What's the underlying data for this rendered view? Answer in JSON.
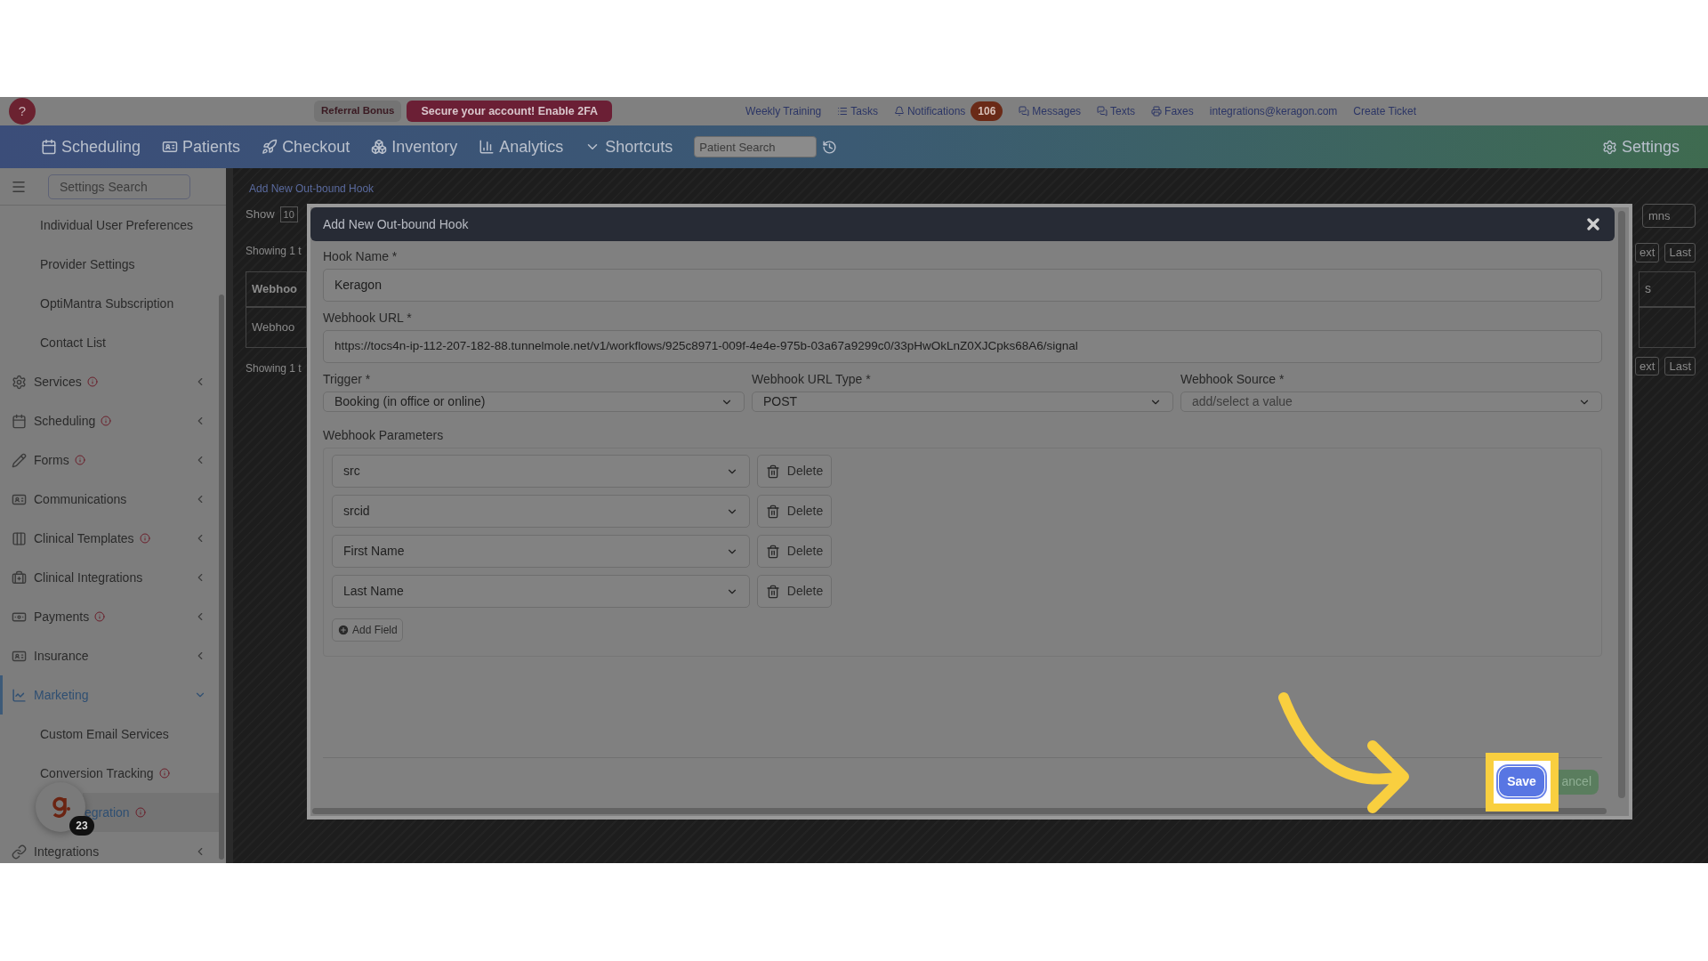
{
  "top_bar": {
    "help": "?",
    "badges": [
      {
        "label": "Referral Bonus",
        "kind": "plain"
      },
      {
        "label": "Secure your account! Enable 2FA",
        "kind": "alert"
      }
    ],
    "links": [
      {
        "label": "Weekly Training"
      },
      {
        "label": "Tasks"
      },
      {
        "label": "Notifications",
        "count": "106"
      },
      {
        "label": "Messages"
      },
      {
        "label": "Texts"
      },
      {
        "label": "Faxes"
      },
      {
        "label": "integrations@keragon.com"
      },
      {
        "label": "Create Ticket"
      }
    ]
  },
  "nav": {
    "items": [
      {
        "label": "Scheduling"
      },
      {
        "label": "Patients"
      },
      {
        "label": "Checkout"
      },
      {
        "label": "Inventory"
      },
      {
        "label": "Analytics"
      },
      {
        "label": "Shortcuts"
      }
    ],
    "search_placeholder": "Patient Search",
    "settings": "Settings"
  },
  "sidebar": {
    "search_placeholder": "Settings Search",
    "items": [
      {
        "label": "Individual User Preferences",
        "kind": "sub",
        "info": false,
        "selected": false
      },
      {
        "label": "Provider Settings",
        "kind": "sub",
        "info": false,
        "selected": false
      },
      {
        "label": "OptiMantra Subscription",
        "kind": "sub",
        "info": false,
        "selected": false
      },
      {
        "label": "Contact List",
        "kind": "sub",
        "info": false,
        "selected": false
      },
      {
        "label": "Services",
        "kind": "section",
        "info": true,
        "expanded": false,
        "selected": false
      },
      {
        "label": "Scheduling",
        "kind": "section",
        "info": true,
        "expanded": false,
        "selected": false
      },
      {
        "label": "Forms",
        "kind": "section",
        "info": true,
        "expanded": false,
        "selected": false
      },
      {
        "label": "Communications",
        "kind": "section",
        "info": false,
        "expanded": false,
        "selected": false
      },
      {
        "label": "Clinical Templates",
        "kind": "section",
        "info": true,
        "expanded": false,
        "selected": false
      },
      {
        "label": "Clinical Integrations",
        "kind": "section",
        "info": false,
        "expanded": false,
        "selected": false
      },
      {
        "label": "Payments",
        "kind": "section",
        "info": true,
        "expanded": false,
        "selected": false
      },
      {
        "label": "Insurance",
        "kind": "section",
        "info": false,
        "expanded": false,
        "selected": false
      },
      {
        "label": "Marketing",
        "kind": "section",
        "info": false,
        "expanded": true,
        "selected": true
      },
      {
        "label": "Custom Email Services",
        "kind": "sub",
        "info": false,
        "selected": false
      },
      {
        "label": "Conversion Tracking",
        "kind": "sub",
        "info": true,
        "selected": false
      },
      {
        "label": "egration",
        "kind": "sub",
        "info": true,
        "selected": true
      },
      {
        "label": "Integrations",
        "kind": "section",
        "info": false,
        "expanded": false,
        "selected": false
      }
    ]
  },
  "background": {
    "link": "Add New Out-bound Hook",
    "show_label": "Show",
    "show_value": "10",
    "left_texts": [
      "Showing 1 t",
      "Webhoo",
      "Webhoo",
      "Showing 1 t"
    ],
    "columns_button": "mns",
    "pager_top": [
      "ext",
      "Last"
    ],
    "table_header": "s",
    "pager_bottom": [
      "ext",
      "Last"
    ]
  },
  "modal": {
    "title": "Add New Out-bound Hook",
    "hook_name": {
      "label": "Hook Name *",
      "value": "Keragon"
    },
    "webhook_url": {
      "label": "Webhook URL *",
      "value": "https://tocs4n-ip-112-207-182-88.tunnelmole.net/v1/workflows/925c8971-009f-4e4e-975b-03a67a9299c0/33pHwOkLnZ0XJCpks68A6/signal"
    },
    "selects": [
      {
        "label": "Trigger *",
        "value": "Booking (in office or online)"
      },
      {
        "label": "Webhook URL Type *",
        "value": "POST"
      },
      {
        "label": "Webhook Source *",
        "placeholder": "add/select a value"
      }
    ],
    "parameters_label": "Webhook Parameters",
    "parameters": [
      {
        "value": "src",
        "delete": "Delete"
      },
      {
        "value": "srcid",
        "delete": "Delete"
      },
      {
        "value": "First Name",
        "delete": "Delete"
      },
      {
        "value": "Last Name",
        "delete": "Delete"
      }
    ],
    "add_field": "Add Field",
    "save": "Save",
    "cancel": "ancel"
  },
  "chat_widget": {
    "badge": "23"
  }
}
